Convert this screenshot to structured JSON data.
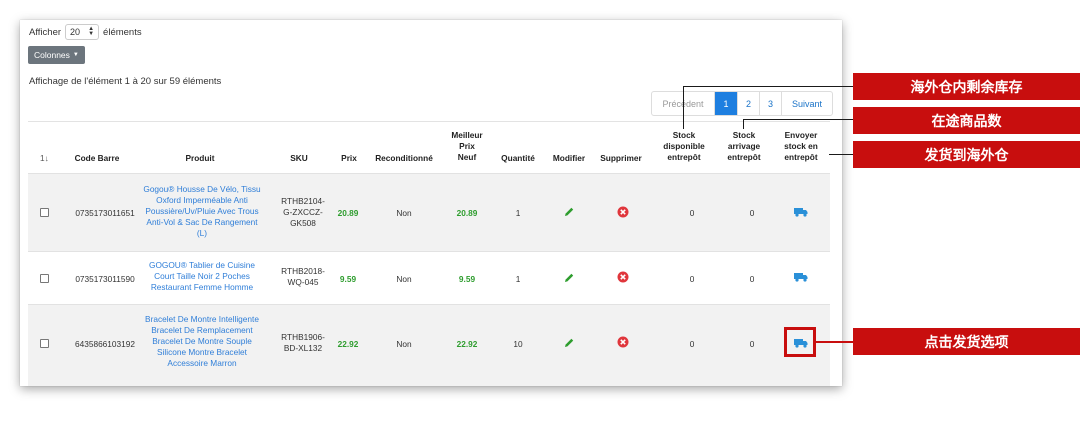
{
  "controls": {
    "show_label": "Afficher",
    "page_size": "20",
    "show_suffix": "éléments",
    "columns_button": "Colonnes",
    "summary": "Affichage de l'élément 1 à 20 sur 59 éléments"
  },
  "pagination": {
    "prev": "Précédent",
    "pages": [
      "1",
      "2",
      "3"
    ],
    "next": "Suivant",
    "active": "1"
  },
  "table": {
    "headers": {
      "sort": "1↓",
      "barcode": "Code Barre",
      "product": "Produit",
      "sku": "SKU",
      "price": "Prix",
      "refurb": "Reconditionné",
      "best_new_price": [
        "Meilleur",
        "Prix",
        "Neuf"
      ],
      "quantity": "Quantité",
      "edit": "Modifier",
      "delete": "Supprimer",
      "stock_available": [
        "Stock",
        "disponible",
        "entrepôt"
      ],
      "stock_arrival": [
        "Stock",
        "arrivage",
        "entrepôt"
      ],
      "send_stock": [
        "Envoyer",
        "stock en",
        "entrepôt"
      ]
    },
    "rows": [
      {
        "barcode": "0735173011651",
        "product_lines": [
          "Gogou® Housse De Vélo, Tissu",
          "Oxford Imperméable Anti",
          "Poussière/Uv/Pluie Avec Trous",
          "Anti-Vol & Sac De Rangement",
          "(L)"
        ],
        "sku_lines": [
          "RTHB2104-",
          "G-ZXCCZ-",
          "GK508"
        ],
        "price": "20.89",
        "refurb": "Non",
        "best_new_price": "20.89",
        "quantity": "1",
        "stock_available": "0",
        "stock_arrival": "0"
      },
      {
        "barcode": "0735173011590",
        "product_lines": [
          "GOGOU® Tablier de Cuisine",
          "Court Taille Noir 2 Poches",
          "Restaurant Femme Homme"
        ],
        "sku_lines": [
          "RTHB2018-",
          "WQ-045"
        ],
        "price": "9.59",
        "refurb": "Non",
        "best_new_price": "9.59",
        "quantity": "1",
        "stock_available": "0",
        "stock_arrival": "0"
      },
      {
        "barcode": "6435866103192",
        "product_lines": [
          "Bracelet De Montre Intelligente",
          "Bracelet De Remplacement",
          "Bracelet De Montre Souple",
          "Silicone Montre Bracelet",
          "Accessoire Marron"
        ],
        "sku_lines": [
          "RTHB1906-",
          "BD-XL132"
        ],
        "price": "22.92",
        "refurb": "Non",
        "best_new_price": "22.92",
        "quantity": "10",
        "stock_available": "0",
        "stock_arrival": "0"
      }
    ]
  },
  "annotations": {
    "overseas_stock": "海外仓内剩余库存",
    "in_transit": "在途商品数",
    "ship_to_overseas": "发货到海外仓",
    "click_ship_option": "点击发货选项"
  },
  "icons": {
    "edit": "pencil-icon",
    "delete": "x-circle-icon",
    "send": "truck-icon",
    "select_caret": "sort-arrows-icon",
    "dropdown_caret": "caret-down-icon"
  },
  "colors": {
    "accent_blue": "#1e7fe0",
    "link_blue": "#2f7ed8",
    "price_green": "#2e9d2e",
    "delete_red": "#e0363c",
    "truck_blue": "#2a90d8",
    "annotation_red": "#c80e0e",
    "button_gray": "#6c757d"
  }
}
